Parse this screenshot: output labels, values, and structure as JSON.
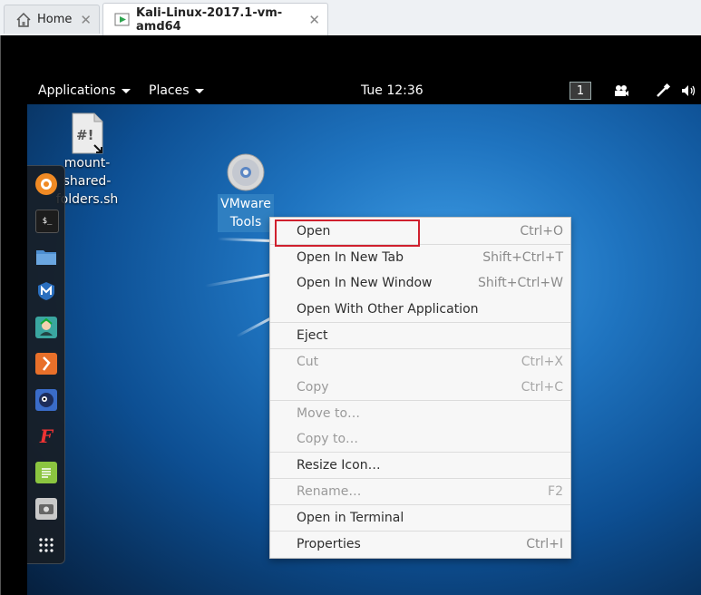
{
  "tabs": [
    {
      "label": "Home",
      "icon": "home-icon",
      "close": "✕"
    },
    {
      "label": "Kali-Linux-2017.1-vm-amd64",
      "icon": "vm-icon",
      "close": "✕"
    }
  ],
  "panel": {
    "applications": "Applications",
    "places": "Places",
    "clock": "Tue 12:36",
    "workspace": "1"
  },
  "desktop_icons": {
    "script": {
      "badge": "#!",
      "line1": "mount-",
      "line2": "shared-",
      "line3": "folders.sh"
    },
    "vmware": {
      "line1": "VMware",
      "line2": "Tools"
    }
  },
  "dock": [
    {
      "name": "firefox-icon",
      "color": "#f08a24"
    },
    {
      "name": "terminal-icon",
      "color": "#1c1c1c"
    },
    {
      "name": "files-icon",
      "color": "#4d8fd1"
    },
    {
      "name": "metasploit-icon",
      "color": "#2a6fbf"
    },
    {
      "name": "armitage-icon",
      "color": "#3aa6a0"
    },
    {
      "name": "burpsuite-icon",
      "color": "#e8702a"
    },
    {
      "name": "beef-icon",
      "color": "#3a6cc8"
    },
    {
      "name": "faraday-icon",
      "color": "#d83a2a"
    },
    {
      "name": "leafpad-icon",
      "color": "#8bc540"
    },
    {
      "name": "screenshot-icon",
      "color": "#c9c9c9"
    },
    {
      "name": "app-grid-icon",
      "color": "#ffffff"
    }
  ],
  "context_menu": [
    {
      "label": "Open",
      "shortcut": "Ctrl+O",
      "disabled": false
    },
    {
      "label": "Open In New Tab",
      "shortcut": "Shift+Ctrl+T",
      "disabled": false
    },
    {
      "label": "Open In New Window",
      "shortcut": "Shift+Ctrl+W",
      "disabled": false
    },
    {
      "label": "Open With Other Application",
      "shortcut": "",
      "disabled": false
    },
    {
      "label": "Eject",
      "shortcut": "",
      "disabled": false
    },
    {
      "label": "Cut",
      "shortcut": "Ctrl+X",
      "disabled": true
    },
    {
      "label": "Copy",
      "shortcut": "Ctrl+C",
      "disabled": true
    },
    {
      "label": "Move to…",
      "shortcut": "",
      "disabled": true
    },
    {
      "label": "Copy to…",
      "shortcut": "",
      "disabled": true
    },
    {
      "label": "Resize Icon…",
      "shortcut": "",
      "disabled": false
    },
    {
      "label": "Rename…",
      "shortcut": "F2",
      "disabled": true
    },
    {
      "label": "Open in Terminal",
      "shortcut": "",
      "disabled": false
    },
    {
      "label": "Properties",
      "shortcut": "Ctrl+I",
      "disabled": false
    }
  ],
  "colors": {
    "highlight_box": "#d0202e",
    "selection": "#2f7fc1"
  }
}
